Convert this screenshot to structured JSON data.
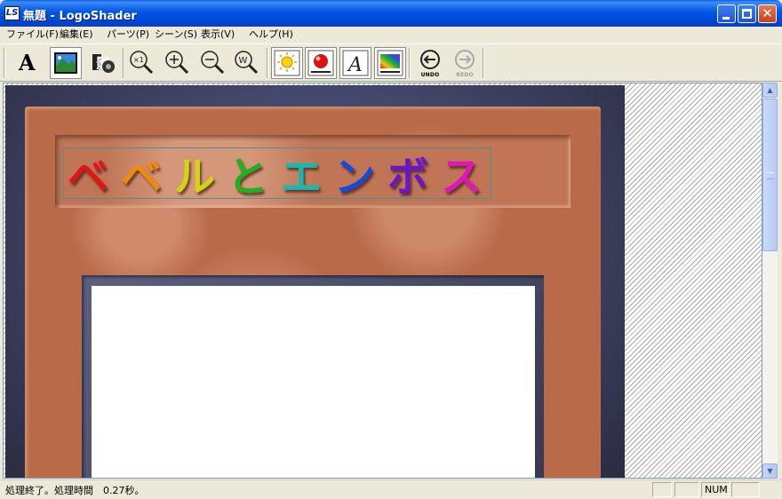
{
  "window": {
    "title": "無題 - LogoShader",
    "icon_label": "LS"
  },
  "menu": [
    {
      "label": "ファイル(F)"
    },
    {
      "label": "編集(E)"
    },
    {
      "label": "パーツ(P)"
    },
    {
      "label": "シーン(S)"
    },
    {
      "label": "表示(V)"
    },
    {
      "label": "ヘルプ(H)"
    }
  ],
  "toolbar": {
    "text_tool": "A",
    "undo_label": "UNDO",
    "redo_label": "REDO",
    "buttons": [
      "text-icon",
      "background-image-icon",
      "stamp-icon",
      "zoom-actual-icon",
      "zoom-in-icon",
      "zoom-out-icon",
      "zoom-fit-icon",
      "light-icon",
      "sphere-icon",
      "text-style-icon",
      "rainbow-gradient-icon",
      "undo-icon",
      "redo-icon"
    ]
  },
  "canvas": {
    "logo_text": "ベベルとエンボス",
    "logo_colors": [
      "#e01818",
      "#ee8a10",
      "#d4d40a",
      "#20b020",
      "#18b8b0",
      "#1848d8",
      "#6a18c8",
      "#e018b8"
    ]
  },
  "status": {
    "message": "処理終了。処理時間　0.27秒。",
    "num_indicator": "NUM"
  }
}
